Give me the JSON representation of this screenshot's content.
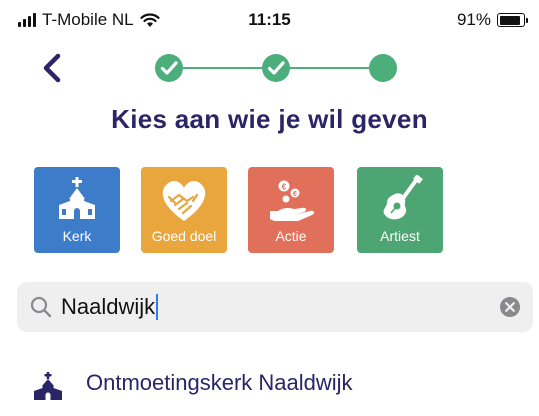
{
  "status_bar": {
    "carrier": "T-Mobile NL",
    "time": "11:15",
    "battery": "91%",
    "battery_level": 0.91
  },
  "nav": {
    "back_icon": "chevron-left-icon",
    "steps_completed": 2,
    "steps_total": 3
  },
  "title": "Kies aan wie je wil geven",
  "categories": [
    {
      "label": "Kerk",
      "icon": "church-icon",
      "color": "#3d7cc9"
    },
    {
      "label": "Goed doel",
      "icon": "heart-hands-icon",
      "color": "#e8a63c"
    },
    {
      "label": "Actie",
      "icon": "donation-hand-icon",
      "color": "#e0705a"
    },
    {
      "label": "Artiest",
      "icon": "guitar-icon",
      "color": "#4da573"
    }
  ],
  "search": {
    "value": "Naaldwijk"
  },
  "results": [
    {
      "label": "Ontmoetingskerk Naaldwijk",
      "icon": "church-icon"
    }
  ],
  "colors": {
    "accent_green": "#4cae7a",
    "title": "#2a2567"
  }
}
